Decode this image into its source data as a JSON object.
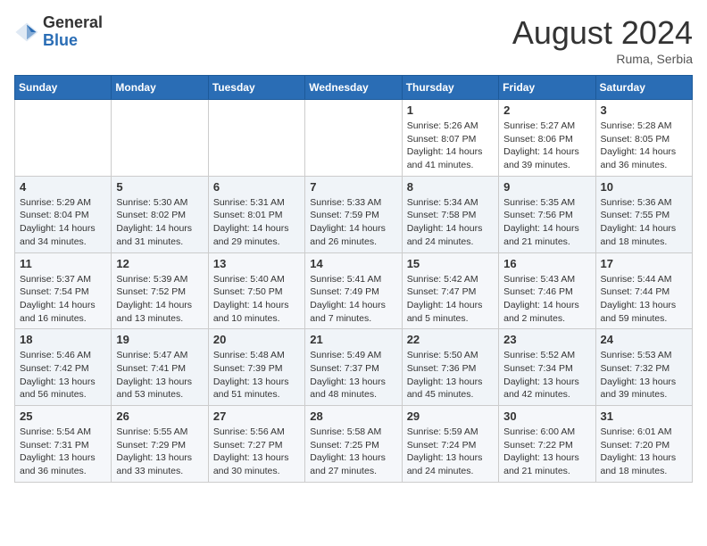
{
  "header": {
    "logo_general": "General",
    "logo_blue": "Blue",
    "month_title": "August 2024",
    "location": "Ruma, Serbia"
  },
  "calendar": {
    "days_of_week": [
      "Sunday",
      "Monday",
      "Tuesday",
      "Wednesday",
      "Thursday",
      "Friday",
      "Saturday"
    ],
    "weeks": [
      [
        {
          "day": "",
          "info": ""
        },
        {
          "day": "",
          "info": ""
        },
        {
          "day": "",
          "info": ""
        },
        {
          "day": "",
          "info": ""
        },
        {
          "day": "1",
          "info": "Sunrise: 5:26 AM\nSunset: 8:07 PM\nDaylight: 14 hours\nand 41 minutes."
        },
        {
          "day": "2",
          "info": "Sunrise: 5:27 AM\nSunset: 8:06 PM\nDaylight: 14 hours\nand 39 minutes."
        },
        {
          "day": "3",
          "info": "Sunrise: 5:28 AM\nSunset: 8:05 PM\nDaylight: 14 hours\nand 36 minutes."
        }
      ],
      [
        {
          "day": "4",
          "info": "Sunrise: 5:29 AM\nSunset: 8:04 PM\nDaylight: 14 hours\nand 34 minutes."
        },
        {
          "day": "5",
          "info": "Sunrise: 5:30 AM\nSunset: 8:02 PM\nDaylight: 14 hours\nand 31 minutes."
        },
        {
          "day": "6",
          "info": "Sunrise: 5:31 AM\nSunset: 8:01 PM\nDaylight: 14 hours\nand 29 minutes."
        },
        {
          "day": "7",
          "info": "Sunrise: 5:33 AM\nSunset: 7:59 PM\nDaylight: 14 hours\nand 26 minutes."
        },
        {
          "day": "8",
          "info": "Sunrise: 5:34 AM\nSunset: 7:58 PM\nDaylight: 14 hours\nand 24 minutes."
        },
        {
          "day": "9",
          "info": "Sunrise: 5:35 AM\nSunset: 7:56 PM\nDaylight: 14 hours\nand 21 minutes."
        },
        {
          "day": "10",
          "info": "Sunrise: 5:36 AM\nSunset: 7:55 PM\nDaylight: 14 hours\nand 18 minutes."
        }
      ],
      [
        {
          "day": "11",
          "info": "Sunrise: 5:37 AM\nSunset: 7:54 PM\nDaylight: 14 hours\nand 16 minutes."
        },
        {
          "day": "12",
          "info": "Sunrise: 5:39 AM\nSunset: 7:52 PM\nDaylight: 14 hours\nand 13 minutes."
        },
        {
          "day": "13",
          "info": "Sunrise: 5:40 AM\nSunset: 7:50 PM\nDaylight: 14 hours\nand 10 minutes."
        },
        {
          "day": "14",
          "info": "Sunrise: 5:41 AM\nSunset: 7:49 PM\nDaylight: 14 hours\nand 7 minutes."
        },
        {
          "day": "15",
          "info": "Sunrise: 5:42 AM\nSunset: 7:47 PM\nDaylight: 14 hours\nand 5 minutes."
        },
        {
          "day": "16",
          "info": "Sunrise: 5:43 AM\nSunset: 7:46 PM\nDaylight: 14 hours\nand 2 minutes."
        },
        {
          "day": "17",
          "info": "Sunrise: 5:44 AM\nSunset: 7:44 PM\nDaylight: 13 hours\nand 59 minutes."
        }
      ],
      [
        {
          "day": "18",
          "info": "Sunrise: 5:46 AM\nSunset: 7:42 PM\nDaylight: 13 hours\nand 56 minutes."
        },
        {
          "day": "19",
          "info": "Sunrise: 5:47 AM\nSunset: 7:41 PM\nDaylight: 13 hours\nand 53 minutes."
        },
        {
          "day": "20",
          "info": "Sunrise: 5:48 AM\nSunset: 7:39 PM\nDaylight: 13 hours\nand 51 minutes."
        },
        {
          "day": "21",
          "info": "Sunrise: 5:49 AM\nSunset: 7:37 PM\nDaylight: 13 hours\nand 48 minutes."
        },
        {
          "day": "22",
          "info": "Sunrise: 5:50 AM\nSunset: 7:36 PM\nDaylight: 13 hours\nand 45 minutes."
        },
        {
          "day": "23",
          "info": "Sunrise: 5:52 AM\nSunset: 7:34 PM\nDaylight: 13 hours\nand 42 minutes."
        },
        {
          "day": "24",
          "info": "Sunrise: 5:53 AM\nSunset: 7:32 PM\nDaylight: 13 hours\nand 39 minutes."
        }
      ],
      [
        {
          "day": "25",
          "info": "Sunrise: 5:54 AM\nSunset: 7:31 PM\nDaylight: 13 hours\nand 36 minutes."
        },
        {
          "day": "26",
          "info": "Sunrise: 5:55 AM\nSunset: 7:29 PM\nDaylight: 13 hours\nand 33 minutes."
        },
        {
          "day": "27",
          "info": "Sunrise: 5:56 AM\nSunset: 7:27 PM\nDaylight: 13 hours\nand 30 minutes."
        },
        {
          "day": "28",
          "info": "Sunrise: 5:58 AM\nSunset: 7:25 PM\nDaylight: 13 hours\nand 27 minutes."
        },
        {
          "day": "29",
          "info": "Sunrise: 5:59 AM\nSunset: 7:24 PM\nDaylight: 13 hours\nand 24 minutes."
        },
        {
          "day": "30",
          "info": "Sunrise: 6:00 AM\nSunset: 7:22 PM\nDaylight: 13 hours\nand 21 minutes."
        },
        {
          "day": "31",
          "info": "Sunrise: 6:01 AM\nSunset: 7:20 PM\nDaylight: 13 hours\nand 18 minutes."
        }
      ]
    ]
  }
}
